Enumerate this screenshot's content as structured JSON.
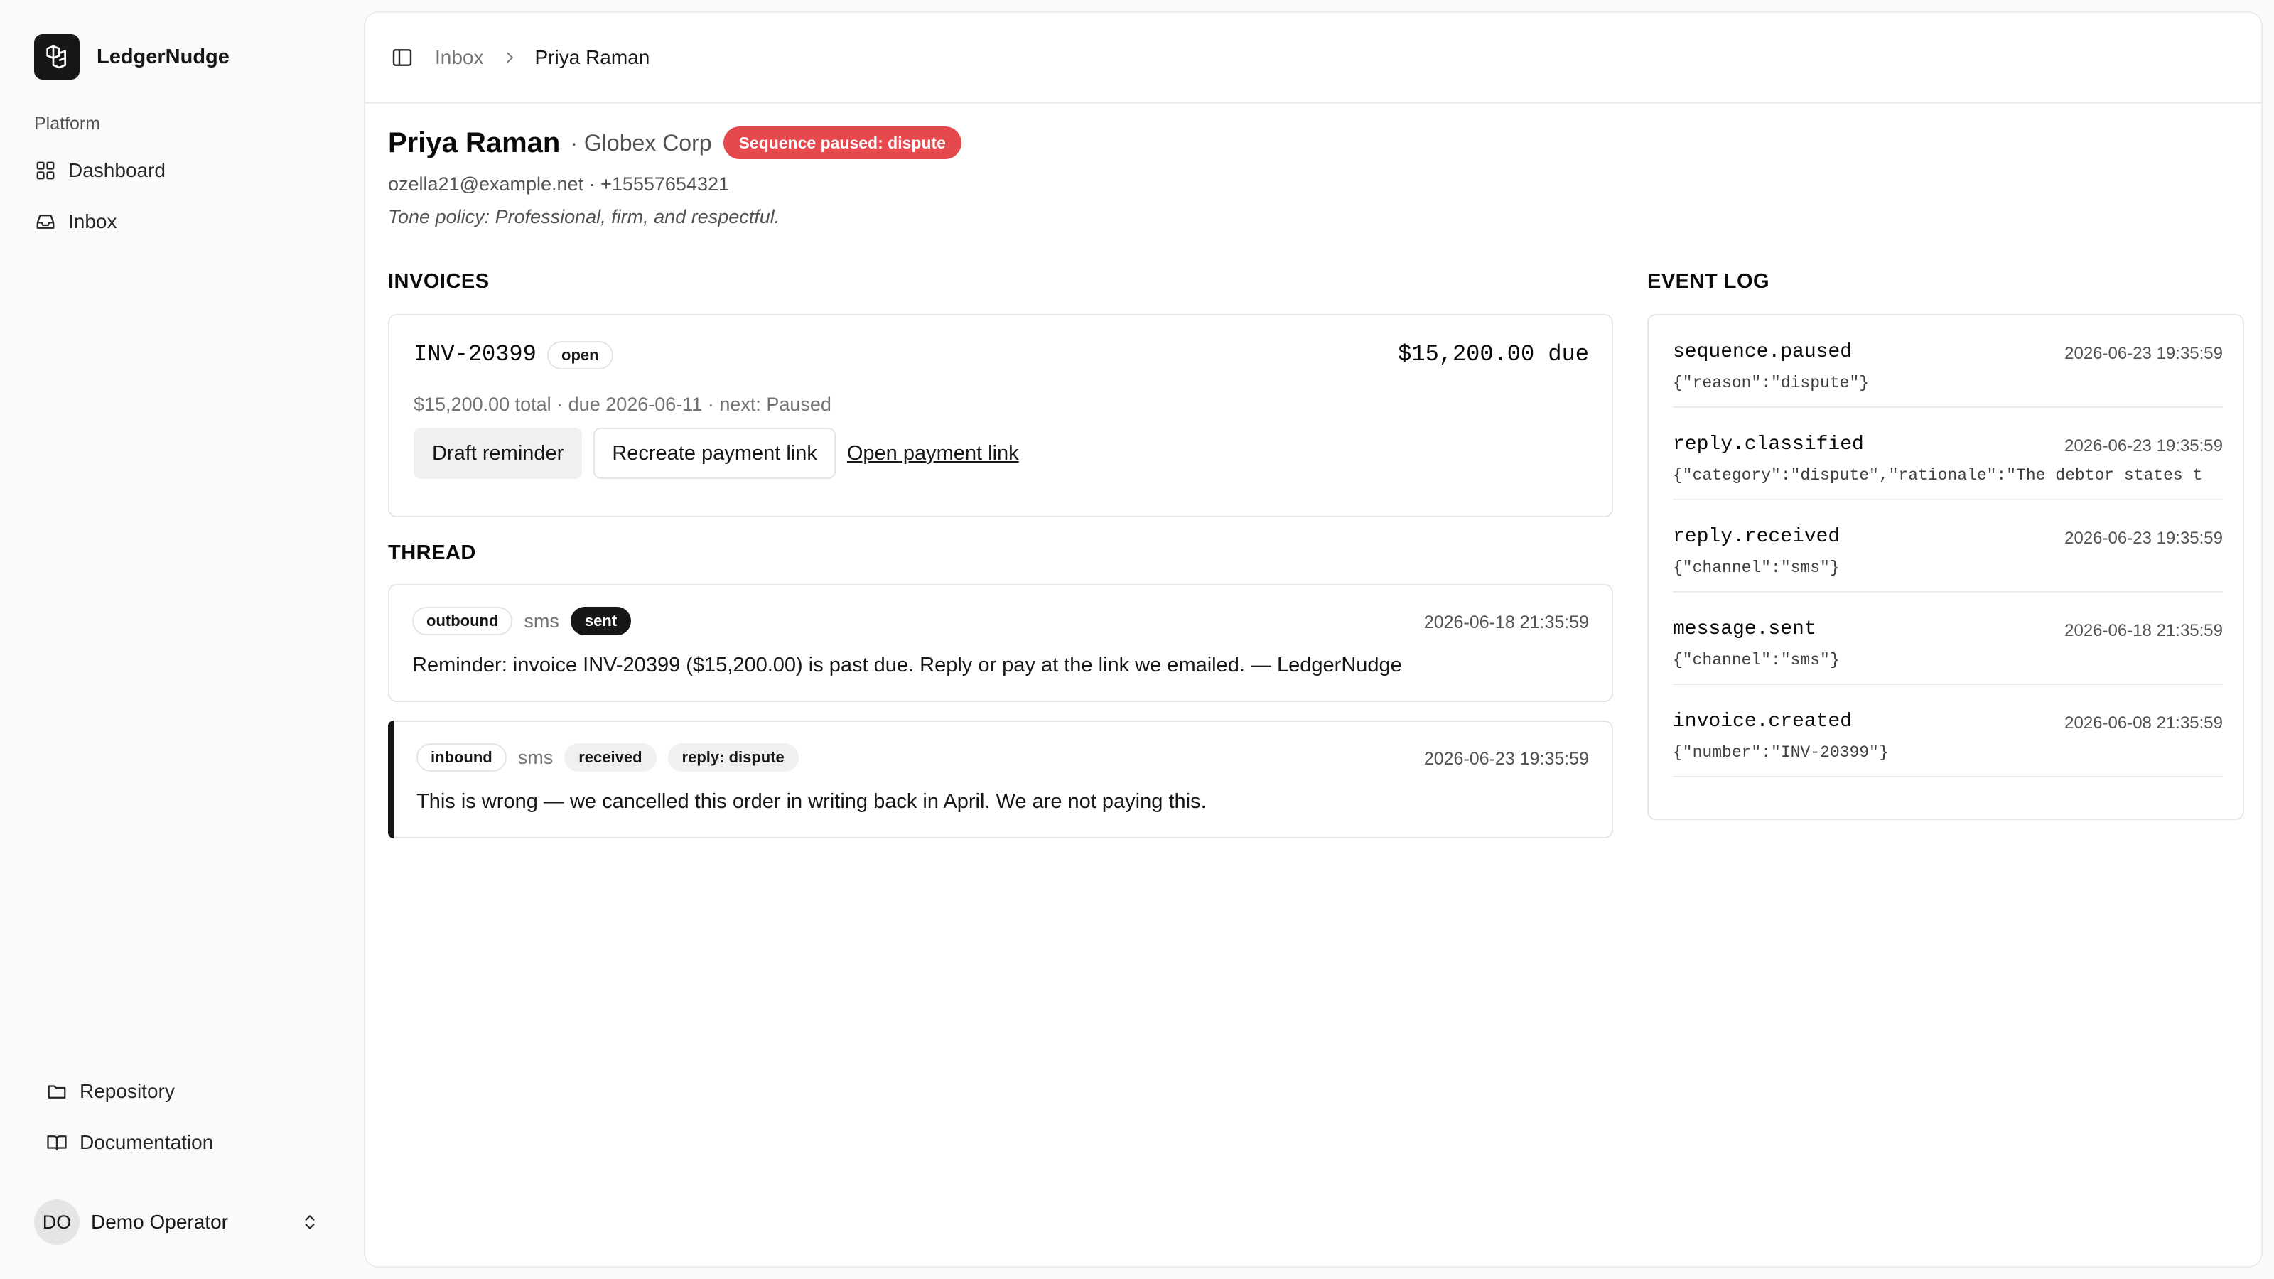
{
  "app": {
    "name": "LedgerNudge"
  },
  "sidebar": {
    "section_label": "Platform",
    "nav": [
      {
        "label": "Dashboard",
        "icon": "grid-icon"
      },
      {
        "label": "Inbox",
        "icon": "inbox-icon"
      }
    ],
    "footer_links": [
      {
        "label": "Repository",
        "icon": "folder-icon"
      },
      {
        "label": "Documentation",
        "icon": "book-icon"
      }
    ],
    "user": {
      "initials": "DO",
      "name": "Demo Operator"
    }
  },
  "breadcrumb": {
    "parent": "Inbox",
    "current": "Priya Raman"
  },
  "debtor": {
    "name": "Priya Raman",
    "company": "· Globex Corp",
    "status_badge": "Sequence paused: dispute",
    "contact": "ozella21@example.net · +15557654321",
    "tone_policy": "Tone policy: Professional, firm, and respectful."
  },
  "invoices": {
    "title": "INVOICES",
    "items": [
      {
        "number": "INV-20399",
        "status": "open",
        "due_label": "$15,200.00 due",
        "meta": "$15,200.00 total · due 2026-06-11 · next: Paused",
        "draft_label": "Draft reminder",
        "recreate_label": "Recreate payment link",
        "open_link_label": "Open payment link"
      }
    ]
  },
  "thread": {
    "title": "THREAD",
    "messages": [
      {
        "direction": "outbound",
        "channel": "sms",
        "badges": [
          "sent"
        ],
        "time": "2026-06-18 21:35:59",
        "body": "Reminder: invoice INV-20399 ($15,200.00) is past due. Reply or pay at the link we emailed. — LedgerNudge"
      },
      {
        "direction": "inbound",
        "channel": "sms",
        "badges": [
          "received",
          "reply: dispute"
        ],
        "time": "2026-06-23 19:35:59",
        "body": "This is wrong — we cancelled this order in writing back in April. We are not paying this."
      }
    ]
  },
  "event_log": {
    "title": "EVENT LOG",
    "events": [
      {
        "name": "sequence.paused",
        "time": "2026-06-23 19:35:59",
        "payload": "{\"reason\":\"dispute\"}"
      },
      {
        "name": "reply.classified",
        "time": "2026-06-23 19:35:59",
        "payload": "{\"category\":\"dispute\",\"rationale\":\"The debtor states t"
      },
      {
        "name": "reply.received",
        "time": "2026-06-23 19:35:59",
        "payload": "{\"channel\":\"sms\"}"
      },
      {
        "name": "message.sent",
        "time": "2026-06-18 21:35:59",
        "payload": "{\"channel\":\"sms\"}"
      },
      {
        "name": "invoice.created",
        "time": "2026-06-08 21:35:59",
        "payload": "{\"number\":\"INV-20399\"}"
      }
    ]
  },
  "colors": {
    "badge_danger": "#e5484d",
    "brand_dark": "#171717"
  }
}
